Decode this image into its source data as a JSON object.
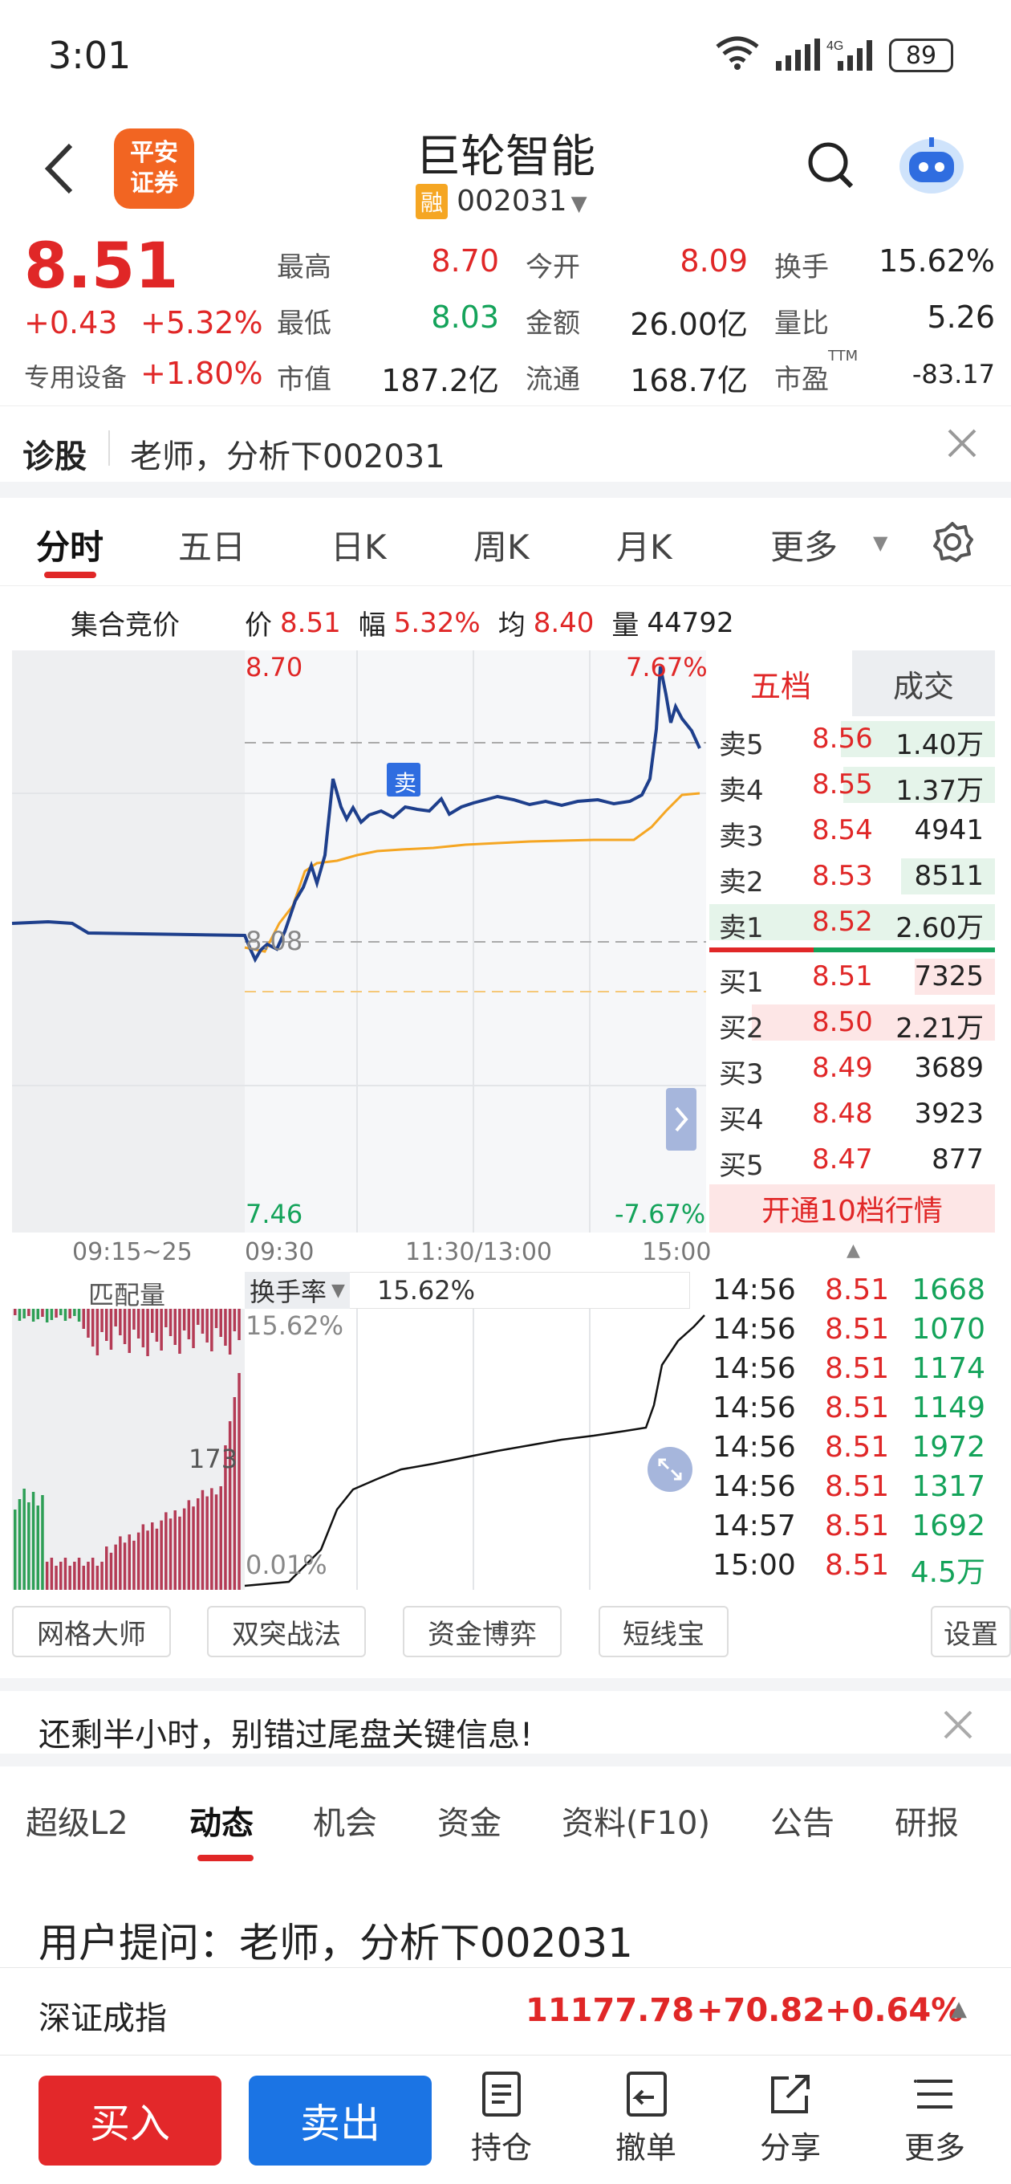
{
  "status_bar": {
    "time": "3:01",
    "battery": "89"
  },
  "header": {
    "back_icon": "chevron-left-icon",
    "logo_text": "平安\n证券",
    "logo_line1": "平安",
    "logo_line2": "证券",
    "stock_name": "巨轮智能",
    "margin_badge": "融",
    "stock_code": "002031",
    "search_icon": "search-icon",
    "robot_icon": "robot-icon"
  },
  "quote": {
    "price": "8.51",
    "change": "+0.43",
    "change_pct": "+5.32%",
    "sector_name": "专用设备",
    "sector_pct": "+1.80%",
    "fields": [
      {
        "label": "最高",
        "value": "8.70",
        "color": "red"
      },
      {
        "label": "今开",
        "value": "8.09",
        "color": "red"
      },
      {
        "label": "换手",
        "value": "15.62%",
        "color": "black"
      },
      {
        "label": "最低",
        "value": "8.03",
        "color": "green"
      },
      {
        "label": "金额",
        "value": "26.00亿",
        "color": "black"
      },
      {
        "label": "量比",
        "value": "5.26",
        "color": "black"
      },
      {
        "label": "市值",
        "value": "187.2亿",
        "color": "black"
      },
      {
        "label": "流通",
        "value": "168.7亿",
        "color": "black"
      },
      {
        "label": "市盈",
        "value": "-83.17",
        "color": "black"
      }
    ],
    "pe_suffix": "TTM"
  },
  "diagnosis": {
    "label": "诊股",
    "text": "老师，分析下002031"
  },
  "tabs": [
    {
      "label": "分时",
      "active": true
    },
    {
      "label": "五日"
    },
    {
      "label": "日K"
    },
    {
      "label": "周K"
    },
    {
      "label": "月K"
    },
    {
      "label": "更多"
    }
  ],
  "chart_info": {
    "title": "集合竞价",
    "price_label": "价",
    "price": "8.51",
    "range_label": "幅",
    "range": "5.32%",
    "avg_label": "均",
    "avg": "8.40",
    "vol_label": "量",
    "vol": "44792"
  },
  "chart_labels": {
    "top_price": "8.70",
    "top_pct": "7.67%",
    "mid_price": "8.08",
    "bottom_price": "7.46",
    "bottom_pct": "-7.67%",
    "sell_marker": "卖",
    "x_ticks": [
      "09:15~25",
      "09:30",
      "11:30/13:00",
      "15:00"
    ]
  },
  "order_book": {
    "tab_five": "五档",
    "tab_deals": "成交",
    "asks": [
      {
        "label": "卖5",
        "price": "8.56",
        "vol": "1.40万",
        "bar": 0.54
      },
      {
        "label": "卖4",
        "price": "8.55",
        "vol": "1.37万",
        "bar": 0.53
      },
      {
        "label": "卖3",
        "price": "8.54",
        "vol": "4941",
        "bar": 0.0
      },
      {
        "label": "卖2",
        "price": "8.53",
        "vol": "8511",
        "bar": 0.33
      },
      {
        "label": "卖1",
        "price": "8.52",
        "vol": "2.60万",
        "bar": 1.0
      }
    ],
    "bids": [
      {
        "label": "买1",
        "price": "8.51",
        "vol": "7325",
        "bar": 0.28
      },
      {
        "label": "买2",
        "price": "8.50",
        "vol": "2.21万",
        "bar": 0.85
      },
      {
        "label": "买3",
        "price": "8.49",
        "vol": "3689",
        "bar": 0.0
      },
      {
        "label": "买4",
        "price": "8.48",
        "vol": "3923",
        "bar": 0.0
      },
      {
        "label": "买5",
        "price": "8.47",
        "vol": "877",
        "bar": 0.0
      }
    ],
    "open_ten": "开通10档行情"
  },
  "volume_panel": {
    "match_label": "匹配量",
    "turnover_dropdown": "换手率",
    "turnover_value": "15.62%",
    "top_label": "15.62%",
    "bottom_label": "0.01%",
    "mid_label": "173"
  },
  "ticks": [
    {
      "time": "14:56",
      "price": "8.51",
      "vol": "1668"
    },
    {
      "time": "14:56",
      "price": "8.51",
      "vol": "1070"
    },
    {
      "time": "14:56",
      "price": "8.51",
      "vol": "1174"
    },
    {
      "time": "14:56",
      "price": "8.51",
      "vol": "1149"
    },
    {
      "time": "14:56",
      "price": "8.51",
      "vol": "1972"
    },
    {
      "time": "14:56",
      "price": "8.51",
      "vol": "1317"
    },
    {
      "time": "14:57",
      "price": "8.51",
      "vol": "1692"
    },
    {
      "time": "15:00",
      "price": "8.51",
      "vol": "4.5万"
    }
  ],
  "tools": [
    "网格大师",
    "双突战法",
    "资金博弈",
    "短线宝",
    "设置"
  ],
  "notice": {
    "text": "还剩半小时，别错过尾盘关键信息!"
  },
  "nav_tabs": [
    {
      "label": "超级L2"
    },
    {
      "label": "动态",
      "active": true
    },
    {
      "label": "机会"
    },
    {
      "label": "资金"
    },
    {
      "label": "资料(F10)"
    },
    {
      "label": "公告"
    },
    {
      "label": "研报"
    }
  ],
  "question": {
    "text": "用户提问：老师，分析下002031"
  },
  "index_bar": {
    "name": "深证成指",
    "value": "11177.78",
    "change": "+70.82",
    "pct": "+0.64%"
  },
  "bottom_bar": {
    "buy": "买入",
    "sell": "卖出",
    "actions": [
      {
        "label": "持仓",
        "icon": "document-icon"
      },
      {
        "label": "撤单",
        "icon": "undo-icon"
      },
      {
        "label": "分享",
        "icon": "share-icon"
      },
      {
        "label": "更多",
        "icon": "menu-icon"
      }
    ]
  },
  "colors": {
    "red": "#e02727",
    "green": "#14a35a",
    "blue": "#1e3f8c",
    "orange": "#f5a623",
    "buy_button": "#e3282a",
    "sell_button": "#1b74e4"
  }
}
